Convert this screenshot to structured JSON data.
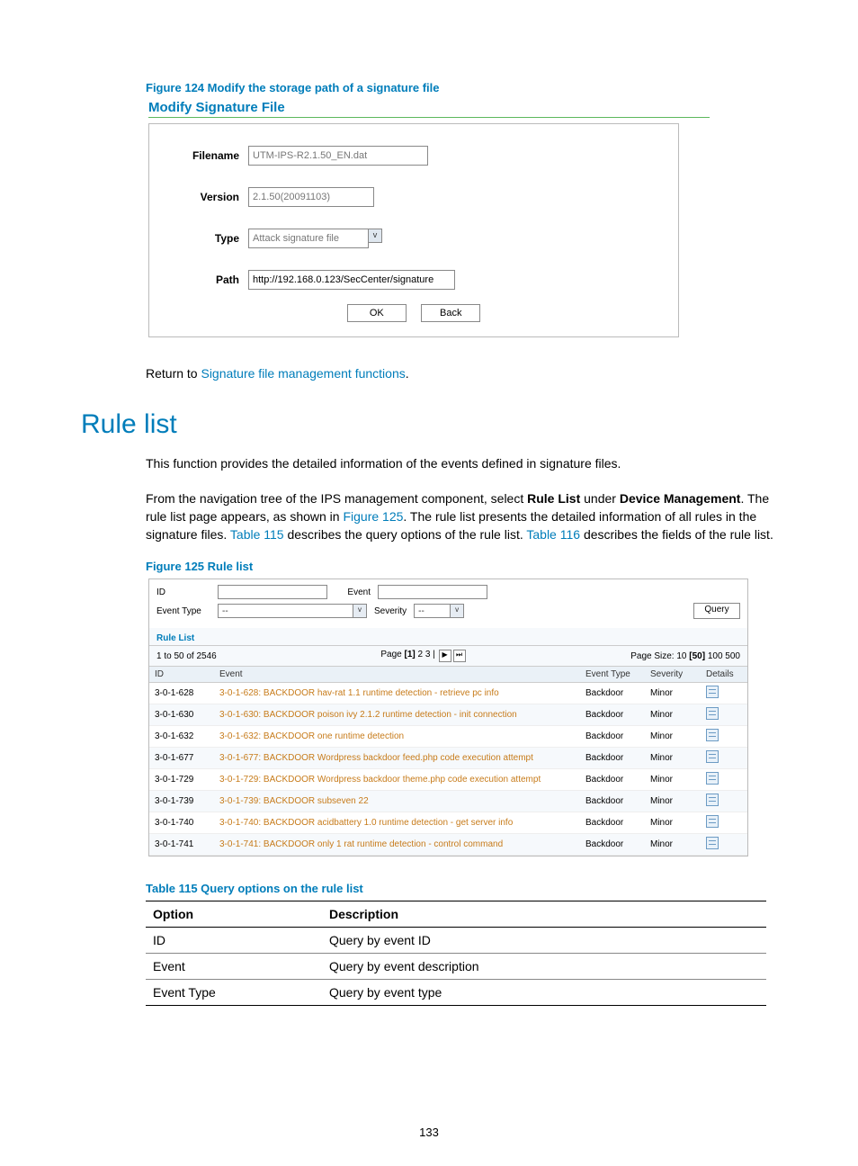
{
  "figure124": {
    "caption": "Figure 124 Modify the storage path of a signature file",
    "panelTitle": "Modify Signature File",
    "form": {
      "filenameLabel": "Filename",
      "filenameValue": "UTM-IPS-R2.1.50_EN.dat",
      "versionLabel": "Version",
      "versionValue": "2.1.50(20091103)",
      "typeLabel": "Type",
      "typeValue": "Attack signature file",
      "pathLabel": "Path",
      "pathValue": "http://192.168.0.123/SecCenter/signature",
      "okLabel": "OK",
      "backLabel": "Back"
    }
  },
  "returnText": {
    "prefix": "Return to ",
    "link": "Signature file management functions",
    "suffix": "."
  },
  "sectionTitle": "Rule list",
  "para1": "This function provides the detailed information of the events defined in signature files.",
  "para2": {
    "seg1": "From the navigation tree of the IPS management component, select ",
    "bold1": "Rule List",
    "seg2": " under ",
    "bold2": "Device Management",
    "seg3": ". The rule list page appears, as shown in ",
    "link1": "Figure 125",
    "seg4": ". The rule list presents the detailed information of all rules in the signature files. ",
    "link2": "Table 115",
    "seg5": " describes the query options of the rule list. ",
    "link3": "Table 116",
    "seg6": " describes the fields of the rule list."
  },
  "figure125": {
    "caption": "Figure 125 Rule list",
    "filters": {
      "idLabel": "ID",
      "eventLabel": "Event",
      "eventTypeLabel": "Event Type",
      "eventTypeValue": "--",
      "severityLabel": "Severity",
      "severityValue": "--",
      "queryLabel": "Query"
    },
    "listTitle": "Rule List",
    "pagerLeft": "1 to 50 of 2546",
    "pagerMidPrefix": "Page ",
    "pagerMidBold": "[1]",
    "pagerMidRest": " 2 3 | ",
    "pageSizePrefix": "Page Size: ",
    "pageSize10": "10",
    "pageSize50": " [50] ",
    "pageSize100": "100",
    "pageSize500": " 500",
    "columns": {
      "id": "ID",
      "event": "Event",
      "etype": "Event Type",
      "sev": "Severity",
      "det": "Details"
    },
    "rows": [
      {
        "id": "3-0-1-628",
        "event": "3-0-1-628: BACKDOOR hav-rat 1.1 runtime detection - retrieve pc info",
        "etype": "Backdoor",
        "sev": "Minor"
      },
      {
        "id": "3-0-1-630",
        "event": "3-0-1-630: BACKDOOR poison ivy 2.1.2 runtime detection - init connection",
        "etype": "Backdoor",
        "sev": "Minor"
      },
      {
        "id": "3-0-1-632",
        "event": "3-0-1-632: BACKDOOR one runtime detection",
        "etype": "Backdoor",
        "sev": "Minor"
      },
      {
        "id": "3-0-1-677",
        "event": "3-0-1-677: BACKDOOR Wordpress backdoor feed.php code execution attempt",
        "etype": "Backdoor",
        "sev": "Minor"
      },
      {
        "id": "3-0-1-729",
        "event": "3-0-1-729: BACKDOOR Wordpress backdoor theme.php code execution attempt",
        "etype": "Backdoor",
        "sev": "Minor"
      },
      {
        "id": "3-0-1-739",
        "event": "3-0-1-739: BACKDOOR subseven 22",
        "etype": "Backdoor",
        "sev": "Minor"
      },
      {
        "id": "3-0-1-740",
        "event": "3-0-1-740: BACKDOOR acidbattery 1.0 runtime detection - get server info",
        "etype": "Backdoor",
        "sev": "Minor"
      },
      {
        "id": "3-0-1-741",
        "event": "3-0-1-741: BACKDOOR only 1 rat runtime detection - control command",
        "etype": "Backdoor",
        "sev": "Minor"
      }
    ]
  },
  "table115": {
    "caption": "Table 115 Query options on the rule list",
    "headers": {
      "option": "Option",
      "desc": "Description"
    },
    "rows": [
      {
        "option": "ID",
        "desc": "Query by event ID"
      },
      {
        "option": "Event",
        "desc": "Query by event description"
      },
      {
        "option": "Event Type",
        "desc": "Query by event type"
      }
    ]
  },
  "pageNumber": "133"
}
